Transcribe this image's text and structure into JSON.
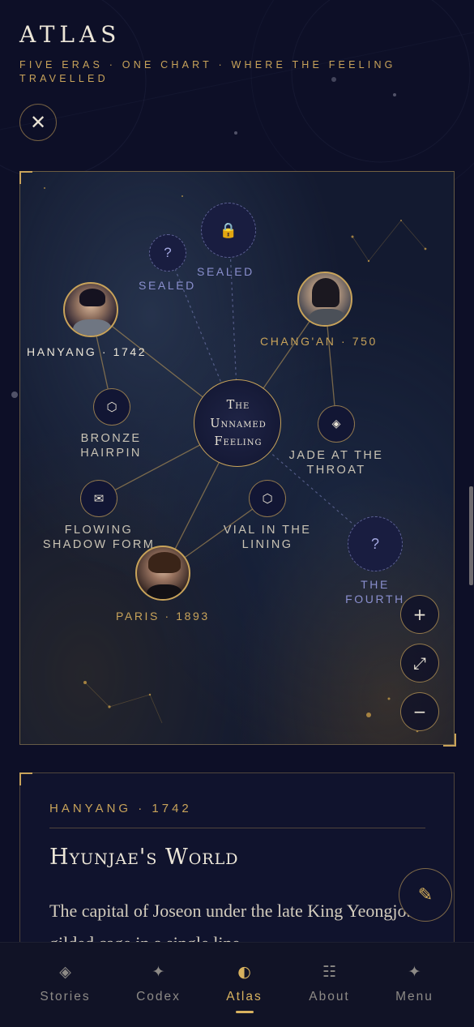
{
  "header": {
    "title": "ATLAS",
    "subtitle": "FIVE ERAS · ONE CHART · WHERE THE FEELING TRAVELLED",
    "close_icon": "close-icon"
  },
  "map": {
    "center": {
      "line1": "The",
      "line2": "Unnamed",
      "line3": "Feeling"
    },
    "eras": [
      {
        "id": "hanyang",
        "label": "HANYANG · 1742",
        "icon": "portrait"
      },
      {
        "id": "changan",
        "label": "CHANG'AN · 750",
        "icon": "portrait"
      },
      {
        "id": "paris",
        "label": "PARIS · 1893",
        "icon": "portrait"
      },
      {
        "id": "sealed-lock",
        "label": "SEALED",
        "icon": "lock-icon"
      },
      {
        "id": "sealed-question",
        "label": "SEALED",
        "icon": "question-icon"
      },
      {
        "id": "fourth",
        "label": "THE FOURTH",
        "icon": "question-icon"
      }
    ],
    "items": [
      {
        "id": "bronze-hairpin",
        "line1": "BRONZE",
        "line2": "HAIRPIN",
        "icon": "hexagon-icon"
      },
      {
        "id": "jade-throat",
        "line1": "JADE AT THE",
        "line2": "THROAT",
        "icon": "diamond-icon"
      },
      {
        "id": "flowing-shadow",
        "line1": "FLOWING",
        "line2": "SHADOW FORM",
        "icon": "envelope-icon"
      },
      {
        "id": "vial-lining",
        "line1": "VIAL IN THE",
        "line2": "LINING",
        "icon": "hexagon-icon"
      }
    ],
    "controls": {
      "zoom_in": "+",
      "fit": "⤢",
      "zoom_out": "−"
    },
    "colors": {
      "accent_gold": "#c8a35a",
      "sealed_blue": "#8a8fce",
      "background": "#0d0f27"
    }
  },
  "detail": {
    "era": "HANYANG · 1742",
    "title": "Hyunjae's World",
    "body": "The capital of Joseon under the late King Yeongjo. A gilded cage in a single line",
    "edit_icon": "pencil-icon"
  },
  "tabs": [
    {
      "label": "Stories",
      "icon": "◈",
      "active": false
    },
    {
      "label": "Codex",
      "icon": "✦",
      "active": false
    },
    {
      "label": "Atlas",
      "icon": "◐",
      "active": true
    },
    {
      "label": "About",
      "icon": "☷",
      "active": false
    },
    {
      "label": "Menu",
      "icon": "✦",
      "active": false
    }
  ]
}
